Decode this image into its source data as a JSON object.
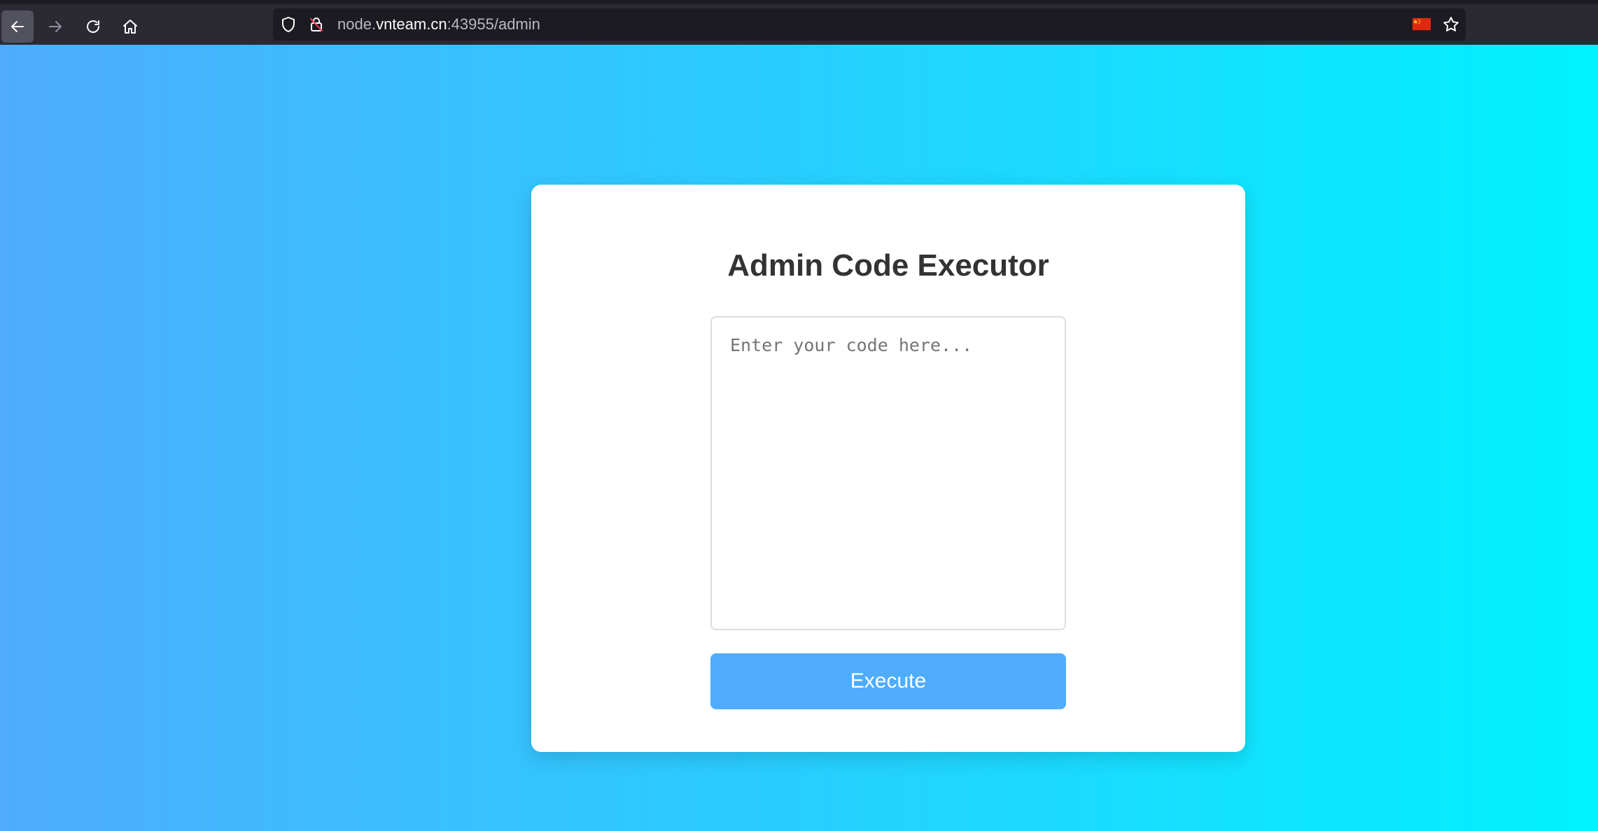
{
  "browser": {
    "url_prefix": "node.",
    "url_domain": "vnteam.cn",
    "url_suffix": ":43955/admin",
    "icons": {
      "back": "arrow-left-icon",
      "forward": "arrow-right-icon",
      "reload": "reload-icon",
      "home": "home-icon",
      "tracking_protection": "shield-icon",
      "connection": "lock-insecure-icon",
      "flag": "china-flag-icon",
      "bookmark": "star-icon"
    }
  },
  "page": {
    "title": "Admin Code Executor",
    "code_input": {
      "value": "",
      "placeholder": "Enter your code here..."
    },
    "execute_label": "Execute"
  },
  "colors": {
    "gradient_start": "#4facfe",
    "gradient_end": "#00f2fe",
    "button": "#4facfe",
    "title": "#333333"
  }
}
